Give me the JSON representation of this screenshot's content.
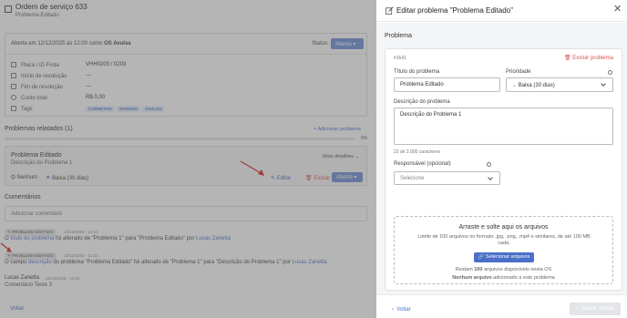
{
  "background": {
    "title": "Ordem de serviço 633",
    "subtitle": "Problema Editado",
    "opened_prefix": "Aberta em 12/12/2025 às 12:00 como",
    "os_type": "OS Avulsa",
    "status_label": "Status:",
    "status_value": "Aberta",
    "fields": [
      {
        "label": "Placa / ID Frota",
        "value": "VHH0203 / 0203"
      },
      {
        "label": "Início de resolução",
        "value": "---"
      },
      {
        "label": "Fim de resolução",
        "value": "---"
      },
      {
        "label": "Custo total",
        "value": "R$ 0,00"
      },
      {
        "label": "Tags",
        "value": ""
      }
    ],
    "tags": [
      "CORRETIVA",
      "INTERNA",
      "AVULSA"
    ],
    "related_title": "Problemas relatados (1)",
    "add_problem": "Adicionar problema",
    "progress_pct": "0%",
    "problem": {
      "title": "Problema Editado",
      "description": "Descrição do Problema 1",
      "more": "Mais detalhes",
      "responsible": "Nenhum",
      "priority": "Baixa (30 dias)",
      "edit": "Editar",
      "delete": "Excluir",
      "status": "Aberto"
    },
    "comments_title": "Comentários",
    "comment_placeholder": "Adicionar comentário",
    "events": [
      {
        "badge": "PROBLEMA EDITADO",
        "date": "12/12/2025 - 14:23",
        "t1": "O ",
        "h1": "título do problema",
        "t2": " foi alterado de \"Problema 1\" para \"Problema Editado\" por ",
        "h2": "Lucas Zanetta"
      },
      {
        "badge": "PROBLEMA EDITADO",
        "date": "12/12/2025 - 14:23",
        "t1": "O campo ",
        "h1": "descrição",
        "t2": " do problema \"Problema Editado\" foi alterado de \"Problema 1\" para \"Descrição do Problema 1\" por ",
        "h2": "Lucas Zanetta"
      }
    ],
    "author": "Lucas Zanetta",
    "author_date": "12/12/2025 - 14:23",
    "author_comment": "Comentário Teste 3",
    "back": "Voltar"
  },
  "drawer": {
    "title": "Editar problema \"Problema Editado\"",
    "section": "Problema",
    "problem_id": "#1641",
    "delete_label": "Excluir problema",
    "title_label": "Título do problema",
    "title_value": "Problema Editado",
    "priority_label": "Prioridade",
    "priority_value": "Baixa (30 dias)",
    "description_label": "Descrição do problema",
    "description_value": "Descrição do Problema 1",
    "counter": "23 de 2.000 caracteres",
    "responsible_label": "Responsável (opcional)",
    "responsible_placeholder": "Selecione",
    "dropzone": {
      "title": "Arraste e solte aqui os arquivos",
      "desc": "Limite de 100 arquivos no formato .jpg, .png, .mp4 e similares, de até 100 MB cada.",
      "button": "Selecionar arquivos",
      "remain_prefix": "Restam",
      "remain_count": "100",
      "remain_suffix": "arquivos disponíveis nesta OS",
      "none_bold": "Nenhum arquivo",
      "none_suffix": "adicionado a este problema"
    },
    "back": "Voltar",
    "save": "Salvar edição"
  },
  "colors": {
    "accent": "#4a6fc9",
    "danger": "#d9534f",
    "status": "#6e8fd8"
  }
}
